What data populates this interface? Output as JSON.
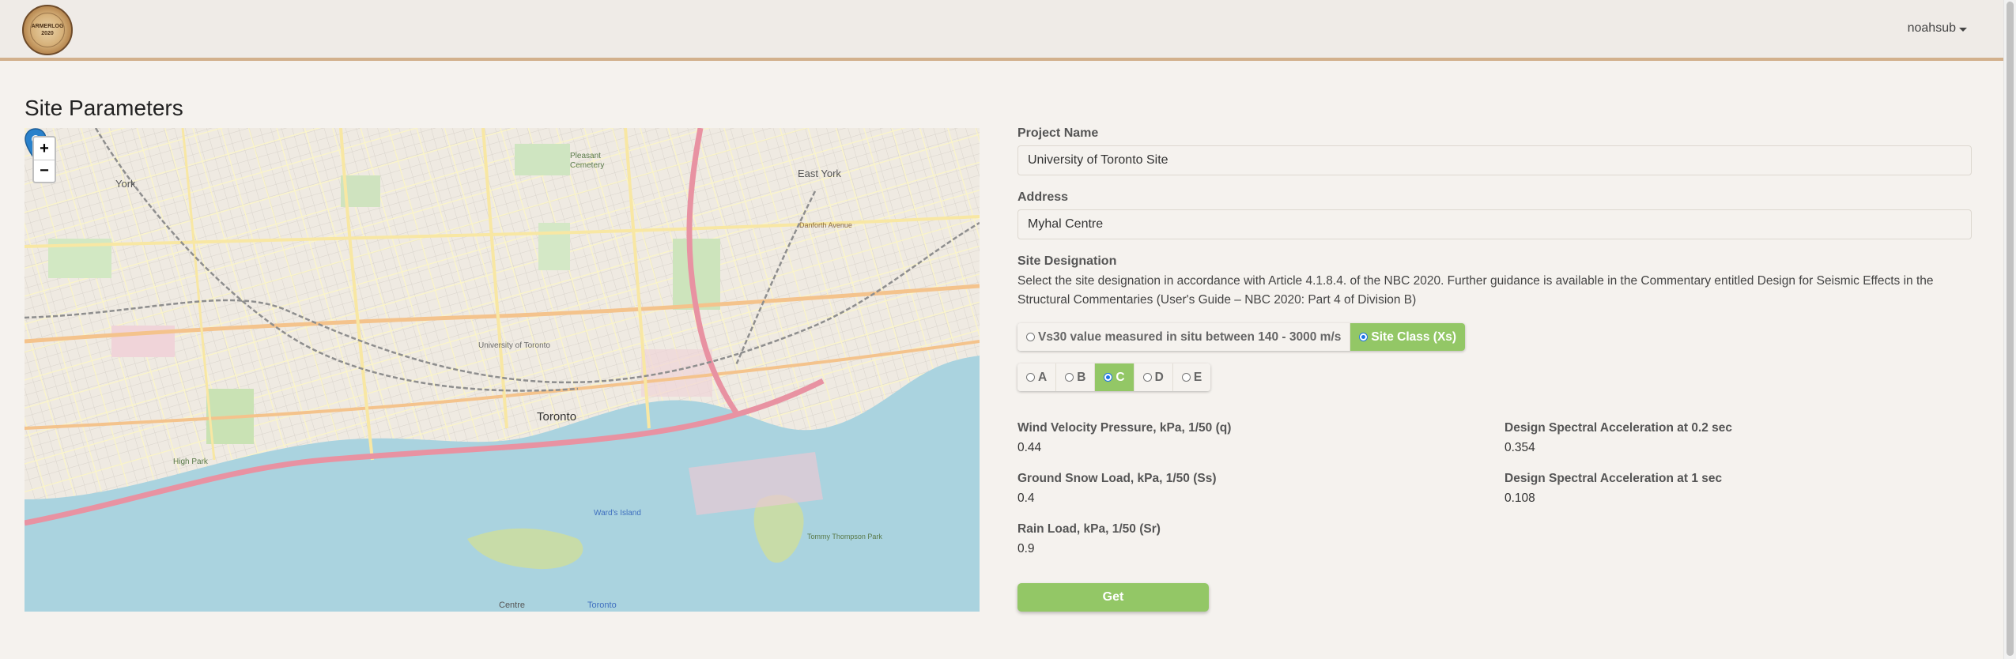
{
  "brand": {
    "logo_line1": "ARMERLOG",
    "logo_line2": "2020"
  },
  "user": {
    "name": "noahsub"
  },
  "page": {
    "title": "Site Parameters"
  },
  "map": {
    "zoom_in": "+",
    "zoom_out": "−",
    "labels": {
      "york": "York",
      "pleasant": "Pleasant",
      "cemetery": "Cemetery",
      "east_york": "East York",
      "danforth": "Danforth Avenue",
      "uoft": "University of Toronto",
      "toronto": "Toronto",
      "high_park": "High Park",
      "wards_island": "Ward's Island",
      "tommy": "Tommy Thompson Park",
      "centre": "Centre",
      "toronto_island": "Toronto"
    }
  },
  "form": {
    "project_name_label": "Project Name",
    "project_name_value": "University of Toronto Site",
    "address_label": "Address",
    "address_value": "Myhal Centre",
    "site_designation_label": "Site Designation",
    "site_designation_help": "Select the site designation in accordance with Article 4.1.8.4. of the NBC 2020. Further guidance is available in the Commentary entitled Design for Seismic Effects in the Structural Commentaries (User's Guide – NBC 2020: Part 4 of Division B)",
    "designation_options": [
      {
        "label": "Vs30 value measured in situ between 140 - 3000 m/s",
        "selected": false
      },
      {
        "label": "Site Class (Xs)",
        "selected": true
      }
    ],
    "site_classes": [
      {
        "label": "A",
        "selected": false
      },
      {
        "label": "B",
        "selected": false
      },
      {
        "label": "C",
        "selected": true
      },
      {
        "label": "D",
        "selected": false
      },
      {
        "label": "E",
        "selected": false
      }
    ]
  },
  "results": {
    "wind": {
      "label": "Wind Velocity Pressure, kPa, 1/50 (q)",
      "value": "0.44"
    },
    "snow": {
      "label": "Ground Snow Load, kPa, 1/50 (Ss)",
      "value": "0.4"
    },
    "rain": {
      "label": "Rain Load, kPa, 1/50 (Sr)",
      "value": "0.9"
    },
    "sa02": {
      "label": "Design Spectral Acceleration at 0.2 sec",
      "value": "0.354"
    },
    "sa1": {
      "label": "Design Spectral Acceleration at 1 sec",
      "value": "0.108"
    }
  },
  "actions": {
    "get_label": "Get"
  },
  "colors": {
    "accent": "#93c766",
    "nav_border": "#d2b08c",
    "water": "#aad3df",
    "highway": "#e892a2"
  }
}
